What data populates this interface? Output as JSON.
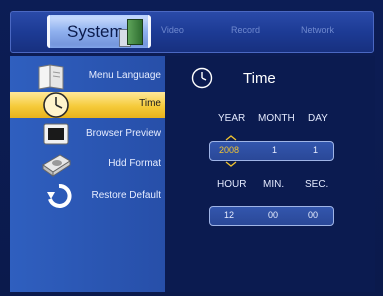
{
  "tabs": {
    "active": "System",
    "items": [
      "Video",
      "Record",
      "Network"
    ]
  },
  "menu": {
    "items": [
      {
        "label": "Menu Language",
        "icon": "book-icon"
      },
      {
        "label": "Time",
        "icon": "clock-icon",
        "selected": true
      },
      {
        "label": "Browser Preview",
        "icon": "monitor-icon"
      },
      {
        "label": "Hdd Format",
        "icon": "hard-drive-icon"
      },
      {
        "label": "Restore Default",
        "icon": "restore-arrow-icon"
      }
    ]
  },
  "panel": {
    "title": "Time",
    "date_headers": [
      "YEAR",
      "MONTH",
      "DAY"
    ],
    "date_values": {
      "year": "2008",
      "month": "1",
      "day": "1"
    },
    "time_headers": [
      "HOUR",
      "MIN.",
      "SEC."
    ],
    "time_values": {
      "hour": "12",
      "min": "00",
      "sec": "00"
    }
  },
  "colors": {
    "selection": "#f5cb3a",
    "panel_blue": "#2f5fbf",
    "background": "#0b1b50"
  }
}
